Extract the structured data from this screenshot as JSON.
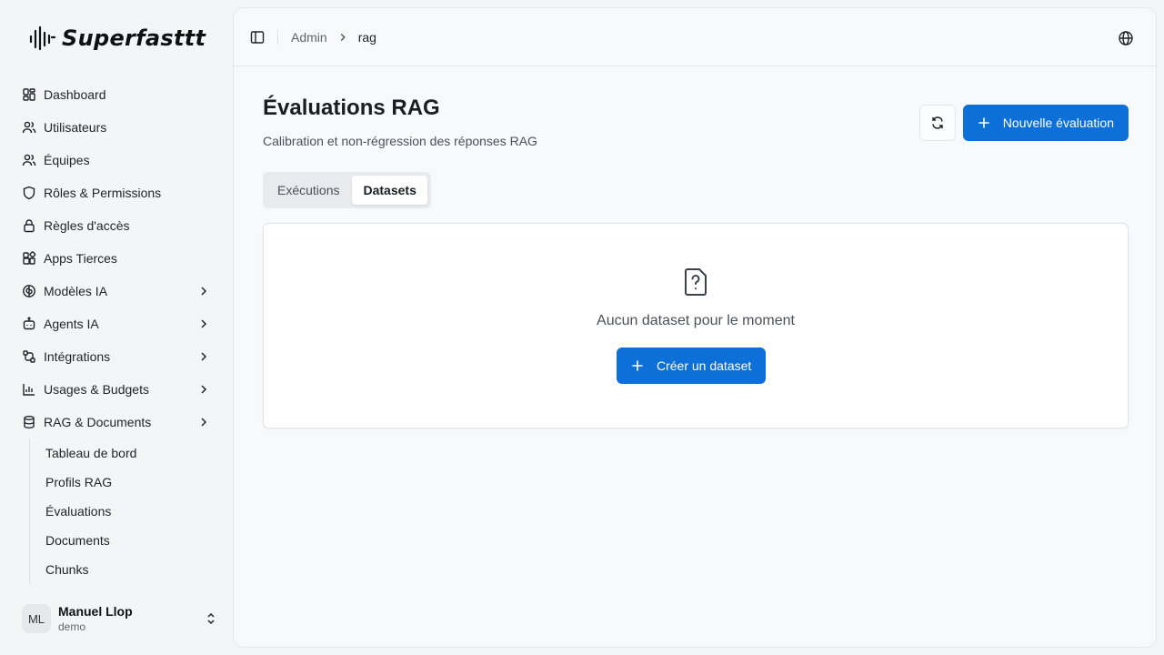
{
  "brand": {
    "name": "Superfasttt"
  },
  "sidebar": {
    "items": [
      {
        "label": "Dashboard",
        "icon": "dashboard-icon"
      },
      {
        "label": "Utilisateurs",
        "icon": "users-icon"
      },
      {
        "label": "Équipes",
        "icon": "team-icon"
      },
      {
        "label": "Rôles & Permissions",
        "icon": "shield-icon"
      },
      {
        "label": "Règles d'accès",
        "icon": "lock-icon"
      },
      {
        "label": "Apps Tierces",
        "icon": "apps-icon"
      },
      {
        "label": "Modèles IA",
        "icon": "brain-icon"
      },
      {
        "label": "Agents IA",
        "icon": "bot-icon"
      },
      {
        "label": "Intégrations",
        "icon": "integrations-icon"
      },
      {
        "label": "Usages & Budgets",
        "icon": "bar-chart-icon"
      },
      {
        "label": "RAG & Documents",
        "icon": "database-icon"
      }
    ],
    "sub_items": [
      "Tableau de bord",
      "Profils RAG",
      "Évaluations",
      "Documents",
      "Chunks"
    ]
  },
  "user": {
    "initials": "ML",
    "name": "Manuel Llop",
    "role": "demo"
  },
  "breadcrumb": {
    "parent": "Admin",
    "current": "rag"
  },
  "page": {
    "title": "Évaluations RAG",
    "subtitle": "Calibration et non-régression des réponses RAG",
    "new_button": "Nouvelle évaluation"
  },
  "tabs": [
    {
      "label": "Exécutions",
      "active": false
    },
    {
      "label": "Datasets",
      "active": true
    }
  ],
  "empty_state": {
    "message": "Aucun dataset pour le moment",
    "button": "Créer un dataset"
  },
  "colors": {
    "primary": "#0d6fd8",
    "background": "#f4f5f7"
  }
}
